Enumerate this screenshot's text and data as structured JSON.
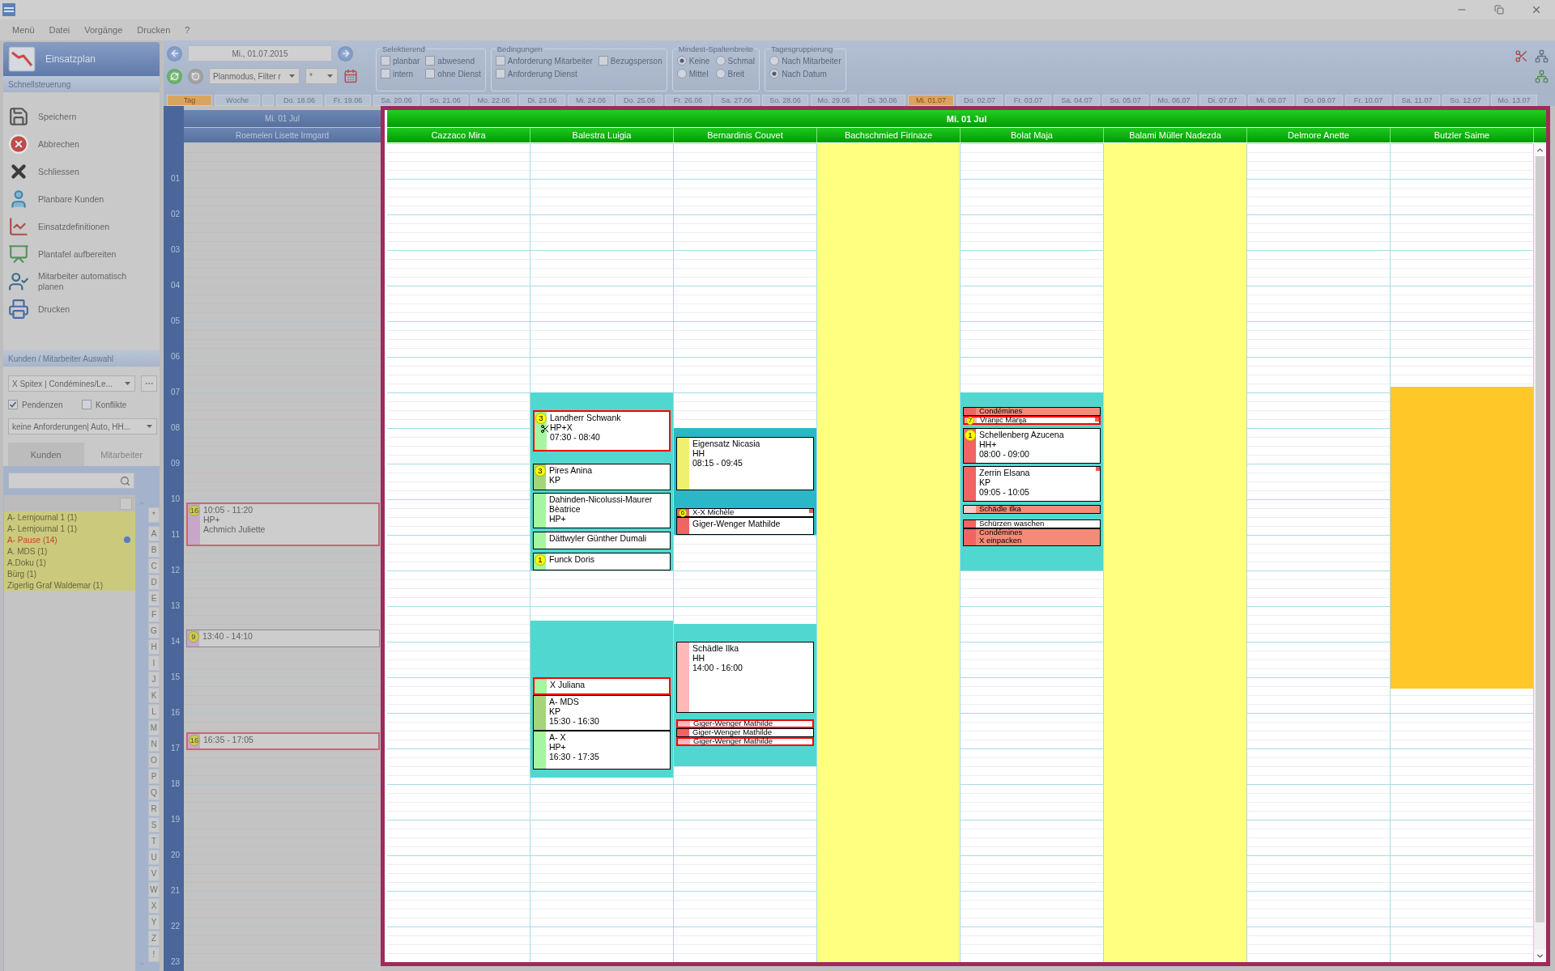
{
  "menu": [
    "Menü",
    "Datei",
    "Vorgänge",
    "Drucken",
    "?"
  ],
  "sidebar": {
    "title": "Einsatzplan",
    "quick_title": "Schnellsteuerung",
    "actions": [
      {
        "label": "Speichern",
        "kind": "save"
      },
      {
        "label": "Abbrechen",
        "kind": "cancel"
      },
      {
        "label": "Schliessen",
        "kind": "close"
      },
      {
        "label": "Planbare Kunden",
        "kind": "customers"
      },
      {
        "label": "Einsatzdefinitionen",
        "kind": "definitions"
      },
      {
        "label": "Plantafel aufbereiten",
        "kind": "prepare"
      },
      {
        "label": "Mitarbeiter automatisch planen",
        "kind": "autoplan"
      },
      {
        "label": "Drucken",
        "kind": "print"
      }
    ],
    "selection_title": "Kunden / Mitarbeiter Auswahl",
    "unit_select": "X Spitex | Condémines/Le...",
    "filters": [
      {
        "label": "Pendenzen",
        "checked": true
      },
      {
        "label": "Konflikte",
        "checked": false
      }
    ],
    "requirement_select": "keine Anforderungen| Auto, HH...",
    "tabs": [
      {
        "label": "Kunden",
        "selected": true
      },
      {
        "label": "Mitarbeiter",
        "selected": false
      }
    ],
    "list": [
      {
        "label": "A- Lernjournal 1 (1)",
        "warning": false,
        "has_info": false
      },
      {
        "label": "A- Lernjournal 1 (1)",
        "warning": false,
        "has_info": false
      },
      {
        "label": "A- Pause (14)",
        "warning": true,
        "has_info": true
      },
      {
        "label": "A. MDS (1)",
        "warning": false,
        "has_info": false
      },
      {
        "label": "A.Doku (1)",
        "warning": false,
        "has_info": false
      },
      {
        "label": "Bürg (1)",
        "warning": false,
        "has_info": false
      },
      {
        "label": "Zigerlig Graf Waldemar (1)",
        "warning": false,
        "has_info": false
      }
    ],
    "letters": [
      "*",
      "A",
      "B",
      "C",
      "D",
      "E",
      "F",
      "G",
      "H",
      "I",
      "J",
      "K",
      "L",
      "M",
      "N",
      "O",
      "P",
      "Q",
      "R",
      "S",
      "T",
      "U",
      "V",
      "W",
      "X",
      "Y",
      "Z",
      "!"
    ]
  },
  "toolbar": {
    "date": "Mi., 01.07.2015",
    "mode_select": "Planmodus, Filter r",
    "filter_select": "*",
    "groups": [
      {
        "title": "Selektierend",
        "kind": "check",
        "options": [
          {
            "label": "planbar",
            "checked": false
          },
          {
            "label": "abwesend",
            "checked": false
          },
          {
            "label": "intern",
            "checked": false
          },
          {
            "label": "ohne Dienst",
            "checked": false
          }
        ]
      },
      {
        "title": "Bedingungen",
        "kind": "check",
        "options": [
          {
            "label": "Anforderung Mitarbeiter",
            "checked": false
          },
          {
            "label": "Bezugsperson",
            "checked": false
          },
          {
            "label": "Anforderung Dienst",
            "checked": false
          }
        ]
      },
      {
        "title": "Mindest-Spaltenbreite",
        "kind": "radio",
        "options": [
          {
            "label": "Keine",
            "selected": true
          },
          {
            "label": "Schmal",
            "selected": false
          },
          {
            "label": "Mittel",
            "selected": false
          },
          {
            "label": "Breit",
            "selected": false
          }
        ]
      },
      {
        "title": "Tagesgruppierung",
        "kind": "radio",
        "options": [
          {
            "label": "Nach Mitarbeiter",
            "selected": false
          },
          {
            "label": "Nach Datum",
            "selected": true
          }
        ]
      }
    ]
  },
  "view_tabs": [
    {
      "label": "Tag",
      "selected": true
    },
    {
      "label": "Woche",
      "selected": false
    }
  ],
  "date_tabs": [
    {
      "label": "Do. 18.06",
      "selected": false
    },
    {
      "label": "Fr. 19.06",
      "selected": false
    },
    {
      "label": "Sa. 20.06",
      "selected": false
    },
    {
      "label": "So. 21.06",
      "selected": false
    },
    {
      "label": "Mo. 22.06",
      "selected": false
    },
    {
      "label": "Di. 23.06",
      "selected": false
    },
    {
      "label": "Mi. 24.06",
      "selected": false
    },
    {
      "label": "Do. 25.06",
      "selected": false
    },
    {
      "label": "Fr. 26.06",
      "selected": false
    },
    {
      "label": "Sa. 27.06",
      "selected": false
    },
    {
      "label": "So. 28.06",
      "selected": false
    },
    {
      "label": "Mo. 29.06",
      "selected": false
    },
    {
      "label": "Di. 30.06",
      "selected": false
    },
    {
      "label": "Mi. 01.07",
      "selected": true
    },
    {
      "label": "Do. 02.07",
      "selected": false
    },
    {
      "label": "Fr. 03.07",
      "selected": false
    },
    {
      "label": "Sa. 04.07",
      "selected": false
    },
    {
      "label": "So. 05.07",
      "selected": false
    },
    {
      "label": "Mo. 06.07",
      "selected": false
    },
    {
      "label": "Di. 07.07",
      "selected": false
    },
    {
      "label": "Mi. 08.07",
      "selected": false
    },
    {
      "label": "Do. 09.07",
      "selected": false
    },
    {
      "label": "Fr. 10.07",
      "selected": false
    },
    {
      "label": "Sa. 11.07",
      "selected": false
    },
    {
      "label": "So. 12.07",
      "selected": false
    },
    {
      "label": "Mo. 13.07",
      "selected": false
    }
  ],
  "background_calendar": {
    "day": "Mi. 01 Jul",
    "employee": "Roemelen Lisette Irmgard",
    "hours": [
      "01",
      "02",
      "03",
      "04",
      "05",
      "06",
      "07",
      "08",
      "09",
      "10",
      "11",
      "12",
      "13",
      "14",
      "15",
      "16",
      "17",
      "18",
      "19",
      "20",
      "21",
      "22",
      "23"
    ],
    "appointments": [
      {
        "time": "10:05 - 11:20",
        "service": "HP+",
        "name": "Achmich Juliette",
        "badge": "16",
        "conflict": true
      },
      {
        "time": "13:40 - 14:10",
        "badge": "9",
        "conflict": false
      },
      {
        "time": "16:35 - 17:05",
        "badge": "16",
        "conflict": true
      }
    ]
  },
  "dialog": {
    "day": "Mi. 01 Jul",
    "columns": [
      {
        "name": "Cazzaco Mira",
        "absent": false
      },
      {
        "name": "Balestra Luigia",
        "absent": false,
        "shifts": [
          {
            "color": "#50d8d0"
          },
          {
            "color": "#50d8d0"
          }
        ],
        "appointments": [
          {
            "kind": "plain",
            "name": "Landherr Schwank",
            "service": "HP+X",
            "time": "07:30 - 08:40",
            "badge": "3",
            "color": "#a6f5a0",
            "conflict": true,
            "flagged": false,
            "split": true
          },
          {
            "kind": "plain",
            "name": "Pires Anina",
            "service": "KP",
            "badge": "3",
            "color": "#a4d47c",
            "conflict": false,
            "flagged": false,
            "split": false
          },
          {
            "kind": "plain",
            "name": "Dahinden-Nicolussi-Maurer Bèatrice",
            "service": "HP+",
            "color": "#a6f5a0",
            "conflict": false,
            "flagged": false,
            "split": false
          },
          {
            "kind": "plain",
            "name": "Dättwyler Günther Dumali",
            "color": "#a6f5a0",
            "conflict": false,
            "flagged": false,
            "split": false
          },
          {
            "kind": "plain",
            "name": "Funck Doris",
            "badge": "1",
            "color": "#a6f5a0",
            "conflict": false,
            "flagged": false,
            "split": false
          },
          {
            "kind": "plain",
            "name": "X Juliana",
            "color": "#a6f5a0",
            "conflict": true,
            "flagged": false,
            "split": false
          },
          {
            "kind": "plain",
            "name": "A- MDS",
            "service": "KP",
            "time": "15:30 - 16:30",
            "color": "#a4d47c",
            "conflict": false,
            "flagged": false,
            "split": false
          },
          {
            "kind": "plain",
            "name": "A- X",
            "service": "HP+",
            "time": "16:30 - 17:35",
            "color": "#a6f5a0",
            "conflict": false,
            "flagged": false,
            "split": false
          }
        ]
      },
      {
        "name": "Bernardinis Couvet",
        "absent": false,
        "shifts": [
          {
            "color": "#2ab8c8"
          },
          {
            "color": "#50d8d0"
          }
        ],
        "appointments": [
          {
            "kind": "plain",
            "name": "Eigensatz Nicasia",
            "service": "HH",
            "time": "08:15 - 09:45",
            "color": "#f0f070",
            "conflict": false,
            "flagged": false,
            "split": false
          },
          {
            "kind": "plain",
            "name": "X-X Michèle",
            "badge": "6",
            "color": "#f06464",
            "conflict": false,
            "flagged": true,
            "split": false
          },
          {
            "kind": "plain",
            "name": "Giger-Wenger Mathilde",
            "color": "#f06464",
            "conflict": false,
            "flagged": false,
            "split": false
          },
          {
            "kind": "plain",
            "name": "Schädle Ilka",
            "service": "HH",
            "time": "14:00 - 16:00",
            "color": "#ffb8b8",
            "conflict": false,
            "flagged": false,
            "split": false
          },
          {
            "kind": "plain",
            "name": "Giger-Wenger Mathilde",
            "color": "#ffb8b8",
            "conflict": true,
            "flagged": false,
            "split": false
          },
          {
            "kind": "plain",
            "name": "Giger-Wenger Mathilde",
            "color": "#f06464",
            "conflict": false,
            "flagged": false,
            "split": false
          },
          {
            "kind": "plain",
            "name": "Giger-Wenger Mathilde",
            "color": "#ffb8b8",
            "conflict": true,
            "flagged": false,
            "split": false
          }
        ]
      },
      {
        "name": "Bachschmied Firinaze",
        "absent": true
      },
      {
        "name": "Bolat Maja",
        "absent": false,
        "shifts": [
          {
            "color": "#50d8d0"
          }
        ],
        "appointments": [
          {
            "kind": "filled",
            "name": "Condémines",
            "color": "#f06464",
            "conflict": false,
            "flagged": false,
            "split": false
          },
          {
            "kind": "plain",
            "name": "Vranjic Marija",
            "badge": "7",
            "color": "#ffb8b8",
            "conflict": true,
            "flagged": true,
            "split": false
          },
          {
            "kind": "plain",
            "name": "Schellenberg Azucena",
            "service": "HH+",
            "time": "08:00 - 09:00",
            "badge": "1",
            "color": "#f06464",
            "conflict": false,
            "flagged": false,
            "split": false
          },
          {
            "kind": "plain",
            "name": "Zerrin Elsana",
            "service": "KP",
            "time": "09:05 - 10:05",
            "color": "#f06464",
            "conflict": false,
            "flagged": true,
            "split": false
          },
          {
            "kind": "filled",
            "name": "Schädle Ilka",
            "color": "#ffc8c8",
            "conflict": false,
            "flagged": false,
            "split": false
          },
          {
            "kind": "plain",
            "name": "Schürzen waschen",
            "color": "#f06464",
            "conflict": false,
            "flagged": false,
            "split": false
          },
          {
            "kind": "filled",
            "name": "Condémines",
            "note": "X einpacken",
            "color": "#f06464",
            "conflict": false,
            "flagged": false,
            "split": false
          }
        ]
      },
      {
        "name": "Balami Müller Nadezda",
        "absent": true
      },
      {
        "name": "Delmore Anette",
        "absent": false
      },
      {
        "name": "Butzler Saime",
        "absent": false,
        "shifts": [
          {
            "color": "#ffc828"
          }
        ]
      }
    ]
  }
}
